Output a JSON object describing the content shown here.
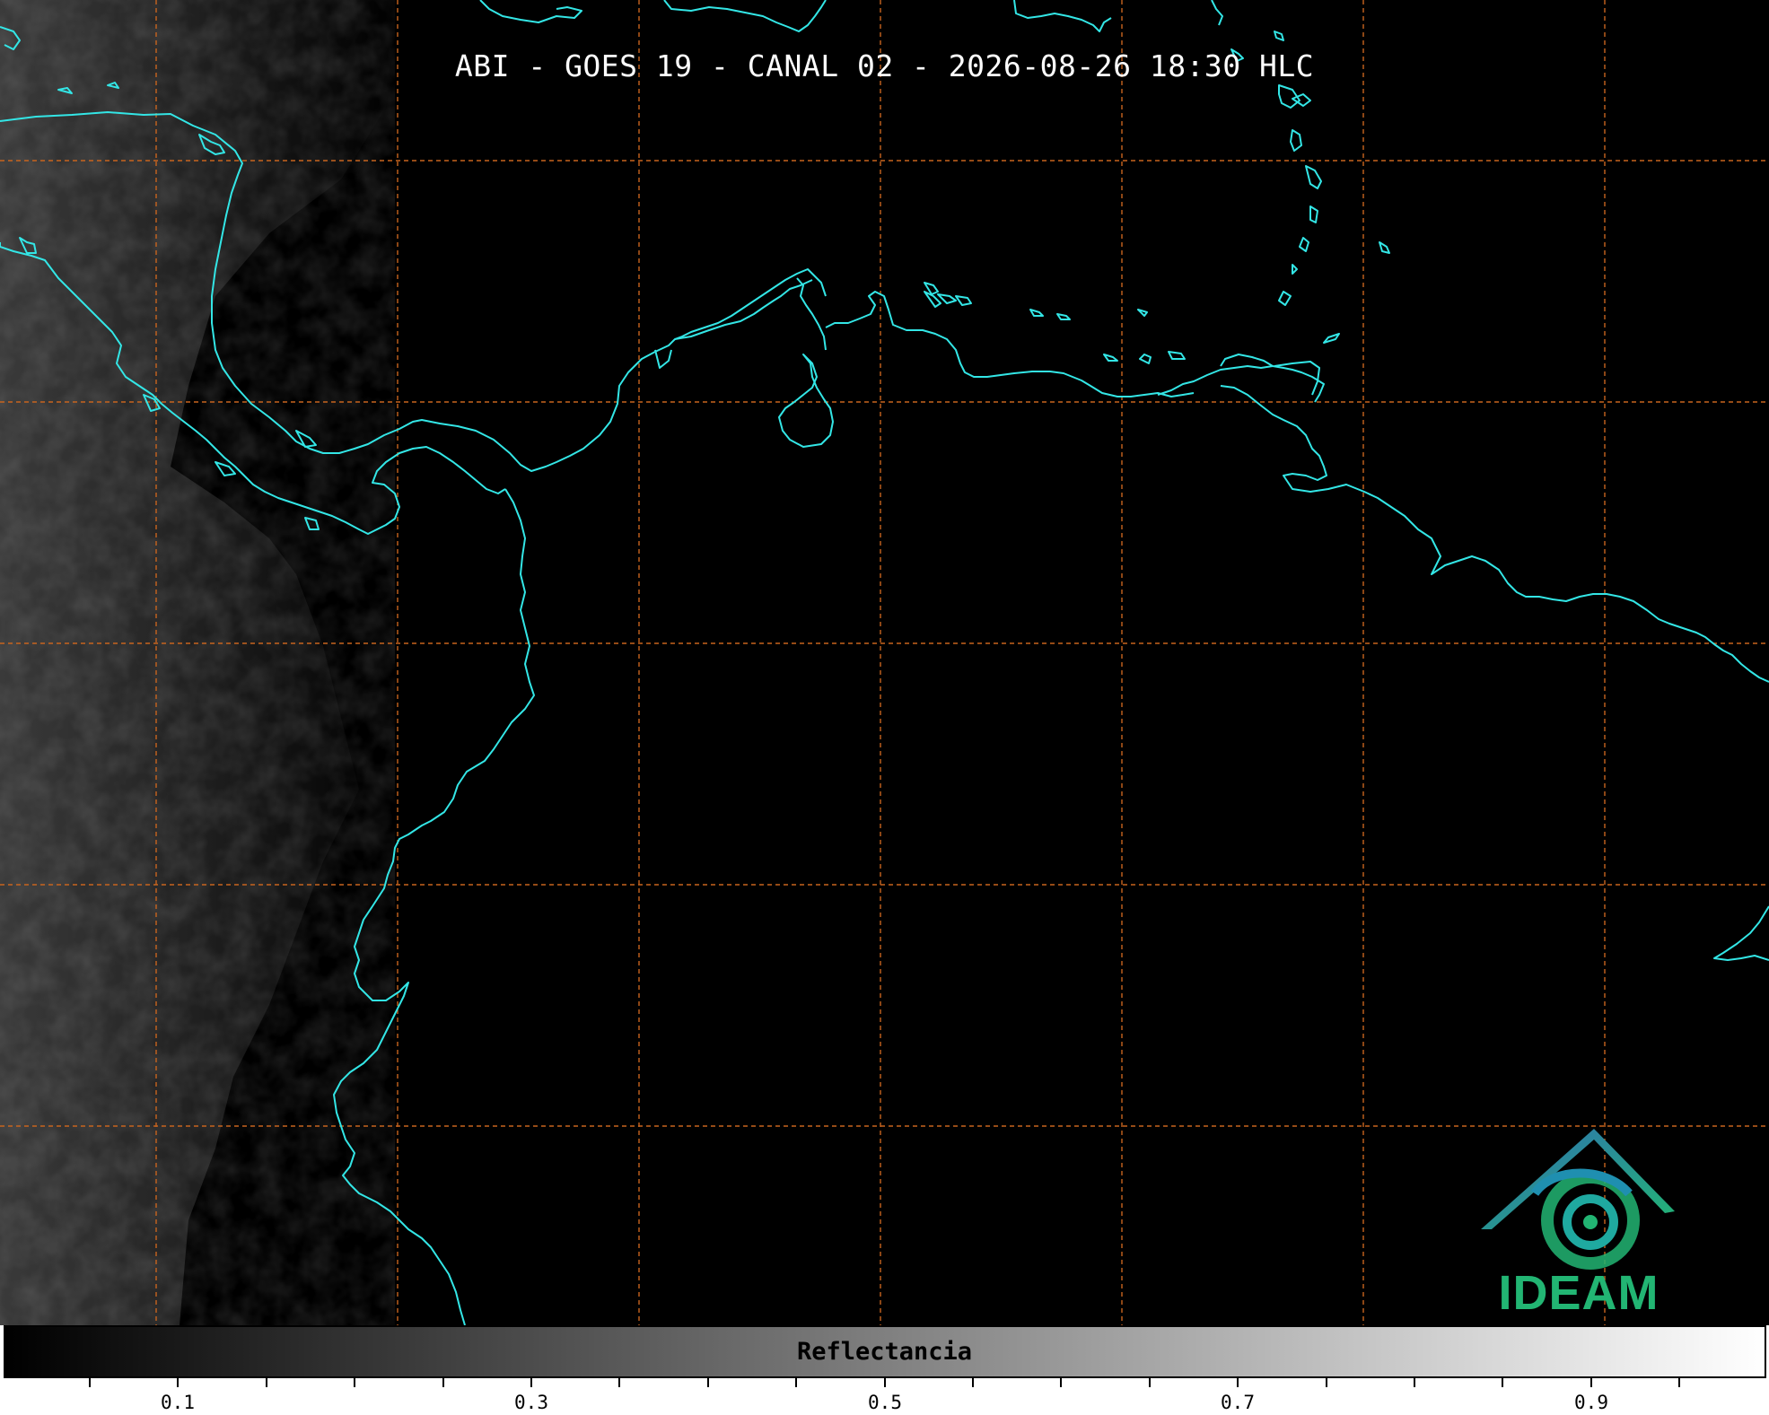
{
  "map": {
    "title": "ABI - GOES 19 - CANAL 02 - 2026-08-26 18:30 HLC",
    "colors": {
      "background": "#000000",
      "coastline": "#33e6e6",
      "gridline": "#c8641e",
      "logo_blue": "#2f6fb3",
      "logo_green": "#22b573"
    }
  },
  "colorbar": {
    "label": "Reflectancia",
    "tick_labels": [
      "0.1",
      "0.3",
      "0.5",
      "0.7",
      "0.9"
    ],
    "gradient_from": "#000000",
    "gradient_to": "#ffffff"
  },
  "logo": {
    "text": "IDEAM"
  }
}
